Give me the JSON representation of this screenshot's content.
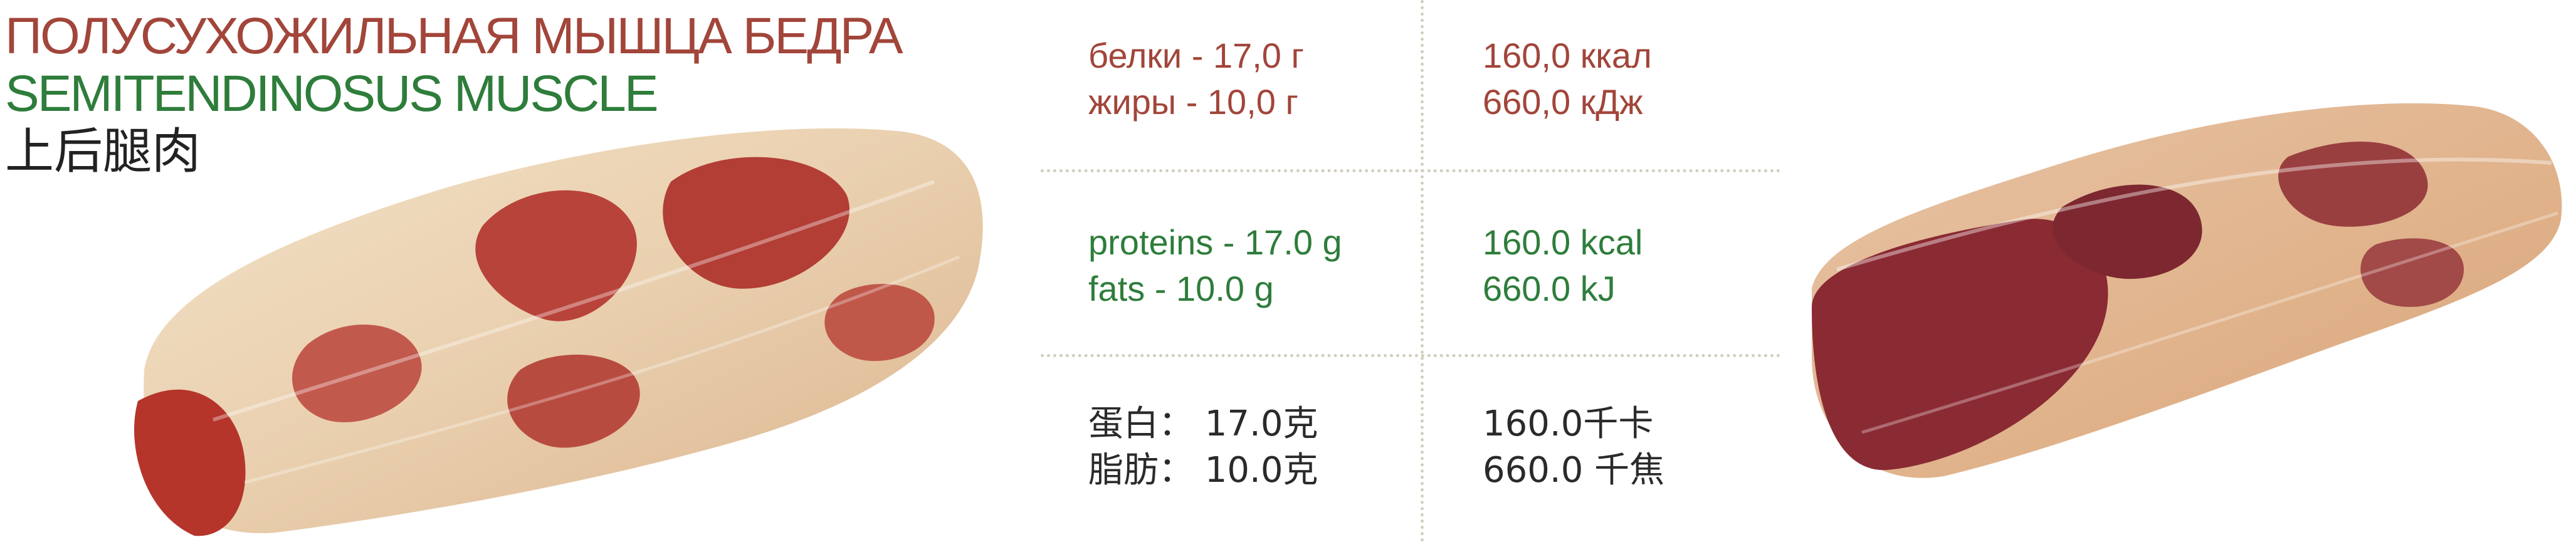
{
  "titles": {
    "ru": "ПОЛУСУХОЖИЛЬНАЯ МЫШЦА БЕДРА",
    "en": "SEMITENDINOSUS MUSCLE",
    "zh": "上后腿肉"
  },
  "nutrition": {
    "ru": {
      "proteins": "белки - 17,0 г",
      "fats": "жиры - 10,0 г",
      "kcal": "160,0 ккал",
      "kj": "660,0 кДж"
    },
    "en": {
      "proteins": "proteins - 17.0 g",
      "fats": "fats - 10.0 g",
      "kcal": "160.0 kcal",
      "kj": "660.0 kJ"
    },
    "zh": {
      "proteins": "蛋白： 17.0克",
      "fats": "脂肪： 10.0克",
      "kcal": "160.0千卡",
      "kj": "660.0 千焦"
    }
  },
  "colors": {
    "russian_text": "#a2453a",
    "english_text": "#2e7d3b",
    "divider": "#d3cfbf"
  },
  "images": [
    "raw-meat-cut-photo",
    "vacuum-packed-meat-photo"
  ]
}
